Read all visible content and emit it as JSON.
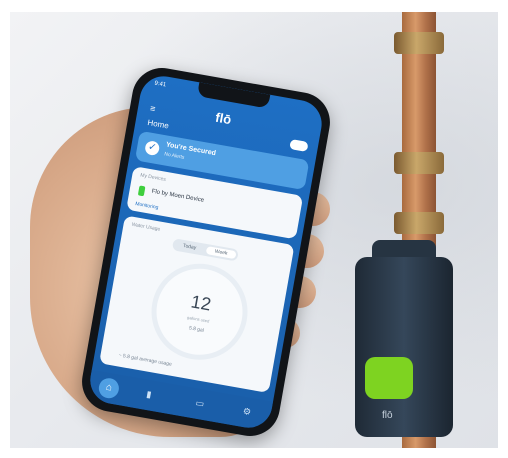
{
  "app": {
    "logo": "flō",
    "screen_title": "Home",
    "status_time": "9:41",
    "secure_title": "You're Secured",
    "secure_sub": "No Alerts",
    "devices_title": "My Devices",
    "device_name": "Flo by Moen Device",
    "device_status": "Monitoring",
    "usage_title": "Water Usage",
    "toggle_today": "Today",
    "toggle_week": "Week",
    "usage_value": "12",
    "usage_unit": "gallons used",
    "usage_sub": "5.8 gal",
    "gpd_line": "~ 5.8 gal  average usage"
  },
  "device": {
    "valve_logo": "flō"
  },
  "icons": {
    "menu": "menu-icon",
    "check": "check-icon",
    "home_tab": "home-icon",
    "stats_tab": "chart-icon",
    "chat_tab": "chat-icon",
    "settings_tab": "gear-icon"
  },
  "colors": {
    "app_blue": "#1e6fc4",
    "valve_green": "#7ed321",
    "copper": "#c9865a"
  }
}
